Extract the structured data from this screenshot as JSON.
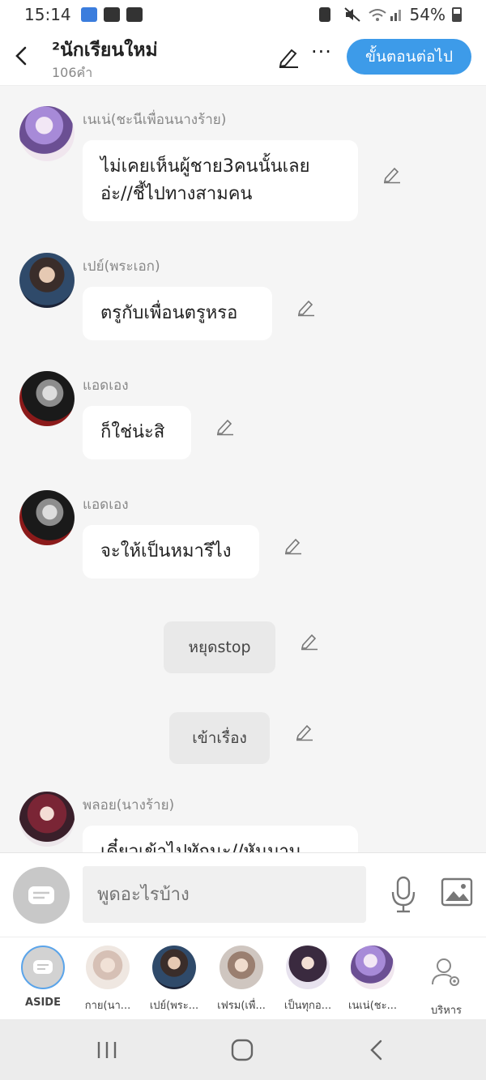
{
  "status_bar": {
    "time": "15:14",
    "battery": "54%"
  },
  "header": {
    "title": "²นักเรียนใหม่",
    "word_count": "106คำ",
    "next_button": "ขั้นตอนต่อไป",
    "more": "···"
  },
  "messages": [
    {
      "kind": "character",
      "name": "เนเน่(ชะนีเพื่อนนางร้าย)",
      "lines": [
        "ไม่เคยเห็นผู้ชาย3คนนั้นเลย",
        "อ่ะ//ชี้ไปทางสามคน"
      ]
    },
    {
      "kind": "character",
      "name": "เปย์(พระเอก)",
      "lines": [
        "ตรูกับเพื่อนตรูหรอ"
      ]
    },
    {
      "kind": "character",
      "name": "แอดเอง",
      "lines": [
        "ก็ใช่น่ะสิ"
      ]
    },
    {
      "kind": "character",
      "name": "แอดเอง",
      "lines": [
        "จะให้เป็นหมารึไง"
      ]
    },
    {
      "kind": "aside",
      "text": "หยุดstop"
    },
    {
      "kind": "aside",
      "text": "เข้าเรื่อง"
    },
    {
      "kind": "character",
      "name": "พลอย(นางร้าย)",
      "lines": [
        "เดี๋ยวเข้าไปทักนะ//หันมาบ"
      ]
    }
  ],
  "input": {
    "placeholder": "พูดอะไรบ้าง"
  },
  "characters": [
    {
      "label": "ASIDE"
    },
    {
      "label": "กาย(นา..."
    },
    {
      "label": "เปย์(พระ..."
    },
    {
      "label": "เฟรม(เพื่..."
    },
    {
      "label": "เป็นทุกอ..."
    },
    {
      "label": "เนเน่(ชะ..."
    }
  ],
  "manage_label": "บริหาร",
  "colors": {
    "accent": "#3d9be9",
    "aside_bubble": "#e9e9e9",
    "background": "#f5f5f5"
  }
}
